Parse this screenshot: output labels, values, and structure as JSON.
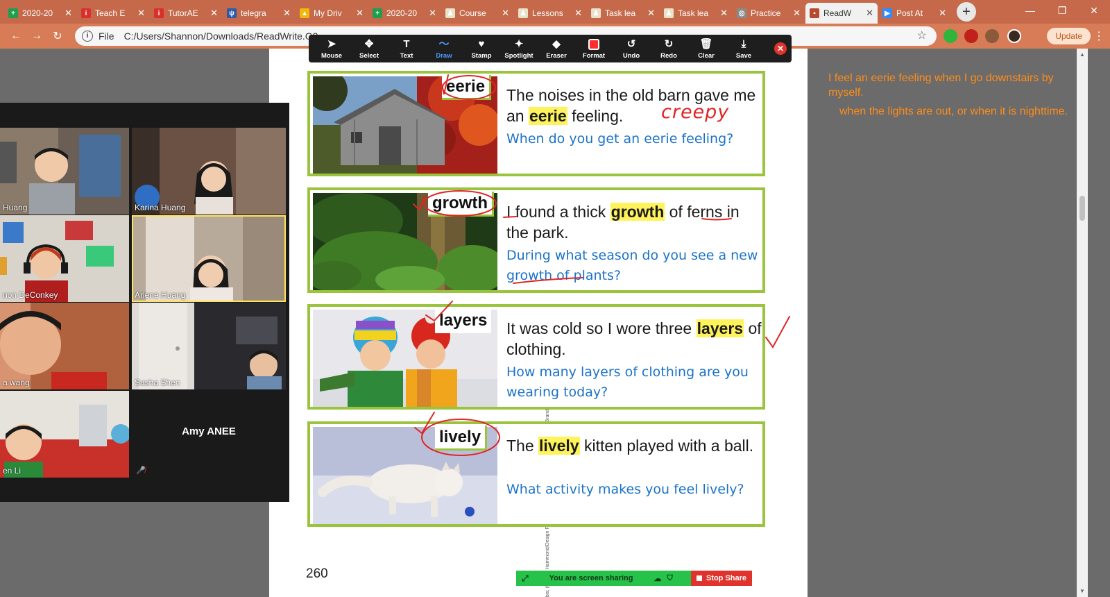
{
  "browser": {
    "tabs": [
      {
        "title": "2020-20",
        "fav_color": "#1e9e4e",
        "fav_glyph": "+"
      },
      {
        "title": "Teach E",
        "fav_color": "#d9302b",
        "fav_glyph": "i"
      },
      {
        "title": "TutorAE",
        "fav_color": "#d9302b",
        "fav_glyph": "i"
      },
      {
        "title": "telegra",
        "fav_color": "#2a5aa8",
        "fav_glyph": "ψ"
      },
      {
        "title": "My Driv",
        "fav_color": "#f2b70a",
        "fav_glyph": "▲"
      },
      {
        "title": "2020-20",
        "fav_color": "#1e9e4e",
        "fav_glyph": "+"
      },
      {
        "title": "Course",
        "fav_color": "#e8e2c8",
        "fav_glyph": "♟"
      },
      {
        "title": "Lessons",
        "fav_color": "#e8e2c8",
        "fav_glyph": "♟"
      },
      {
        "title": "Task lea",
        "fav_color": "#e8e2c8",
        "fav_glyph": "♟"
      },
      {
        "title": "Task lea",
        "fav_color": "#e8e2c8",
        "fav_glyph": "♟"
      },
      {
        "title": "Practice",
        "fav_color": "#8a8a8a",
        "fav_glyph": "◎"
      },
      {
        "title": "ReadW",
        "fav_color": "#b84a2e",
        "fav_glyph": "▪",
        "active": true
      },
      {
        "title": "Post At",
        "fav_color": "#2d8cff",
        "fav_glyph": "▶"
      }
    ],
    "address": {
      "scheme_label": "File",
      "url": "C:/Users/Shannon/Downloads/ReadWrite.G2"
    },
    "update_label": "Update"
  },
  "annotation_toolbar": {
    "tools": [
      {
        "label": "Mouse",
        "icon": "mouse-pointer-icon",
        "glyph": "➤"
      },
      {
        "label": "Select",
        "icon": "move-icon",
        "glyph": "✥"
      },
      {
        "label": "Text",
        "icon": "text-icon",
        "glyph": "T"
      },
      {
        "label": "Draw",
        "icon": "draw-icon",
        "glyph": "〜",
        "active": true
      },
      {
        "label": "Stamp",
        "icon": "stamp-heart-icon",
        "glyph": "♥"
      },
      {
        "label": "Spotlight",
        "icon": "spotlight-wand-icon",
        "glyph": "✦"
      },
      {
        "label": "Eraser",
        "icon": "eraser-icon",
        "glyph": "◆"
      },
      {
        "label": "Format",
        "icon": "format-color-icon",
        "glyph": ""
      },
      {
        "label": "Undo",
        "icon": "undo-icon",
        "glyph": "↺"
      },
      {
        "label": "Redo",
        "icon": "redo-icon",
        "glyph": "↻"
      },
      {
        "label": "Clear",
        "icon": "trash-icon",
        "glyph": "🗑"
      },
      {
        "label": "Save",
        "icon": "save-icon",
        "glyph": "⤓"
      }
    ],
    "format_color": "#ff2d2d",
    "active_color": "#4a9cff"
  },
  "document": {
    "cards": [
      {
        "word": "eerie",
        "sentence_before": "The noises in the old barn gave me an ",
        "sentence_word": "eerie",
        "sentence_after": " feeling.",
        "question": "When do you get an eerie feeling?"
      },
      {
        "word": "growth",
        "sentence_before": "I found a thick ",
        "sentence_word": "growth",
        "sentence_after": " of ferns in the park.",
        "question": "During what season do you see a new growth of plants?"
      },
      {
        "word": "layers",
        "sentence_before": "It was cold so I wore three ",
        "sentence_word": "layers",
        "sentence_after": " of clothing.",
        "question": "How many layers of clothing are you wearing today?"
      },
      {
        "word": "lively",
        "sentence_before": "The ",
        "sentence_word": "lively",
        "sentence_after": " kitten played with a ball.",
        "question": "What activity makes you feel lively?"
      }
    ],
    "page_number": "260",
    "ink_note": "creepy",
    "photo_credit": "(t) Corbis; (tc) Don Hammond/Design Pics/Corbis; (bc) Blend Images/Getty Images; (b) Brand X Pictures/Getty Images"
  },
  "notes": {
    "line1": "I feel an eerie feeling when I go downstairs by myself.",
    "line2": "when the lights are out, or when it is nighttime.",
    "color": "#ff8c1a"
  },
  "gallery": {
    "participants": [
      {
        "name": "Huang",
        "video": "boy-room"
      },
      {
        "name": "Karina Huang",
        "video": "girl-room"
      },
      {
        "name": "non DeConkey",
        "video": "teacher-headset"
      },
      {
        "name": "Arlene Huang",
        "video": "girl-window",
        "speaking": true
      },
      {
        "name": "a wang",
        "video": "child-close"
      },
      {
        "name": "Sasha Shen",
        "video": "boy-door"
      },
      {
        "name": "en Li",
        "video": "boy-chair"
      },
      {
        "name": "Amy ANEE",
        "video": "none",
        "muted": true
      }
    ]
  },
  "share_bar": {
    "message": "You are screen sharing",
    "stop_label": "Stop Share"
  }
}
